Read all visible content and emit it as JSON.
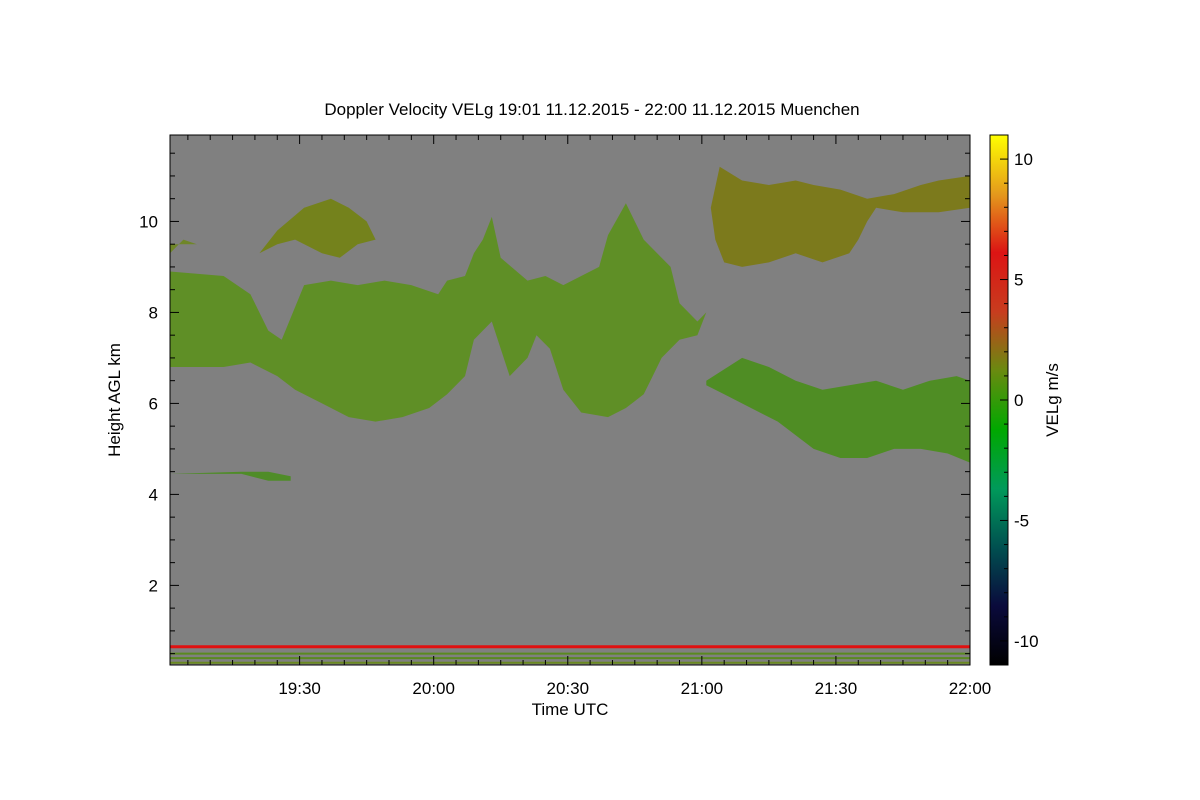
{
  "chart_data": {
    "type": "heatmap",
    "title": "Doppler Velocity VELg   19:01 11.12.2015 - 22:00 11.12.2015 Muenchen",
    "xlabel": "Time UTC",
    "ylabel": "Height AGL km",
    "x_range": [
      "19:01",
      "22:00"
    ],
    "x_tick_labels": [
      "19:30",
      "20:00",
      "20:30",
      "21:00",
      "21:30",
      "22:00"
    ],
    "x_tick_minutes": [
      29,
      59,
      89,
      119,
      149,
      179
    ],
    "ylim": [
      0.25,
      11.9
    ],
    "y_ticks": [
      2,
      4,
      6,
      8,
      10
    ],
    "y_tick_labels": [
      "2",
      "4",
      "6",
      "8",
      "10"
    ],
    "background_color": "#808080",
    "colorbar": {
      "label": "VELg m/s",
      "range": [
        -11,
        11
      ],
      "ticks": [
        10,
        5,
        0,
        -5,
        -10
      ],
      "tick_labels": [
        "10",
        "5",
        "0",
        "-5",
        "-10"
      ],
      "colors": [
        "#000000",
        "#0a0a3c",
        "#005050",
        "#009a5a",
        "#00a800",
        "#6a8a10",
        "#c83c1e",
        "#dc1414",
        "#e49a1c",
        "#ffff00"
      ]
    },
    "cloud_layers": [
      {
        "name": "upper",
        "color": "#6f8628",
        "outline": [
          [
            0,
            9.3
          ],
          [
            3,
            9.6
          ],
          [
            6,
            9.5
          ],
          [
            0,
            9.5
          ]
        ]
      },
      {
        "name": "middle",
        "color": "#5f8f26",
        "outline": [
          [
            0,
            8.9
          ],
          [
            12,
            8.8
          ],
          [
            18,
            8.4
          ],
          [
            22,
            7.6
          ],
          [
            25,
            7.4
          ],
          [
            30,
            8.6
          ],
          [
            36,
            8.7
          ],
          [
            42,
            8.6
          ],
          [
            48,
            8.7
          ],
          [
            54,
            8.6
          ],
          [
            60,
            8.4
          ],
          [
            62,
            8.7
          ],
          [
            66,
            8.8
          ],
          [
            68,
            9.3
          ],
          [
            70,
            9.6
          ],
          [
            72,
            10.1
          ],
          [
            74,
            9.2
          ],
          [
            80,
            8.7
          ],
          [
            84,
            8.8
          ],
          [
            88,
            8.6
          ],
          [
            92,
            8.8
          ],
          [
            96,
            9.0
          ],
          [
            98,
            9.7
          ],
          [
            102,
            10.4
          ],
          [
            106,
            9.6
          ],
          [
            112,
            9.0
          ],
          [
            114,
            8.2
          ],
          [
            118,
            7.8
          ],
          [
            120,
            8.0
          ],
          [
            118,
            7.5
          ],
          [
            114,
            7.4
          ],
          [
            110,
            7.0
          ],
          [
            108,
            6.6
          ],
          [
            106,
            6.2
          ],
          [
            102,
            5.9
          ],
          [
            98,
            5.7
          ],
          [
            92,
            5.8
          ],
          [
            88,
            6.3
          ],
          [
            85,
            7.2
          ],
          [
            82,
            7.5
          ],
          [
            80,
            7.0
          ],
          [
            76,
            6.6
          ],
          [
            74,
            7.2
          ],
          [
            72,
            7.8
          ],
          [
            68,
            7.4
          ],
          [
            66,
            6.6
          ],
          [
            62,
            6.2
          ],
          [
            58,
            5.9
          ],
          [
            52,
            5.7
          ],
          [
            46,
            5.6
          ],
          [
            40,
            5.7
          ],
          [
            34,
            6.0
          ],
          [
            28,
            6.3
          ],
          [
            24,
            6.6
          ],
          [
            18,
            6.9
          ],
          [
            12,
            6.8
          ],
          [
            6,
            6.8
          ],
          [
            0,
            6.8
          ]
        ]
      },
      {
        "name": "upper-left-patch",
        "color": "#74821c",
        "outline": [
          [
            20,
            9.3
          ],
          [
            24,
            9.8
          ],
          [
            30,
            10.3
          ],
          [
            36,
            10.5
          ],
          [
            40,
            10.3
          ],
          [
            44,
            10.0
          ],
          [
            46,
            9.6
          ],
          [
            42,
            9.5
          ],
          [
            38,
            9.2
          ],
          [
            34,
            9.3
          ],
          [
            28,
            9.6
          ],
          [
            24,
            9.5
          ],
          [
            20,
            9.3
          ]
        ]
      },
      {
        "name": "upper-right",
        "color": "#7c7a1c",
        "outline": [
          [
            123,
            11.2
          ],
          [
            128,
            10.9
          ],
          [
            134,
            10.8
          ],
          [
            140,
            10.9
          ],
          [
            144,
            10.8
          ],
          [
            150,
            10.7
          ],
          [
            156,
            10.5
          ],
          [
            162,
            10.6
          ],
          [
            168,
            10.8
          ],
          [
            172,
            10.9
          ],
          [
            179,
            11.0
          ],
          [
            179,
            10.3
          ],
          [
            172,
            10.2
          ],
          [
            164,
            10.2
          ],
          [
            158,
            10.3
          ],
          [
            156,
            10.0
          ],
          [
            154,
            9.6
          ],
          [
            152,
            9.3
          ],
          [
            146,
            9.1
          ],
          [
            140,
            9.3
          ],
          [
            134,
            9.1
          ],
          [
            128,
            9.0
          ],
          [
            124,
            9.1
          ],
          [
            122,
            9.6
          ],
          [
            121,
            10.3
          ],
          [
            123,
            11.2
          ]
        ]
      },
      {
        "name": "lower-right",
        "color": "#4f8d24",
        "outline": [
          [
            120,
            6.5
          ],
          [
            128,
            7.0
          ],
          [
            134,
            6.8
          ],
          [
            140,
            6.5
          ],
          [
            146,
            6.3
          ],
          [
            152,
            6.4
          ],
          [
            158,
            6.5
          ],
          [
            164,
            6.3
          ],
          [
            170,
            6.5
          ],
          [
            176,
            6.6
          ],
          [
            179,
            6.5
          ],
          [
            179,
            4.7
          ],
          [
            174,
            4.9
          ],
          [
            168,
            5.0
          ],
          [
            162,
            5.0
          ],
          [
            156,
            4.8
          ],
          [
            150,
            4.8
          ],
          [
            144,
            5.0
          ],
          [
            140,
            5.3
          ],
          [
            136,
            5.6
          ],
          [
            130,
            5.9
          ],
          [
            124,
            6.2
          ],
          [
            120,
            6.4
          ]
        ]
      },
      {
        "name": "low-left",
        "color": "#4f8c28",
        "outline": [
          [
            0,
            4.45
          ],
          [
            16,
            4.45
          ],
          [
            22,
            4.3
          ],
          [
            27,
            4.3
          ],
          [
            27,
            4.4
          ],
          [
            22,
            4.5
          ],
          [
            16,
            4.5
          ],
          [
            0,
            4.45
          ]
        ]
      }
    ],
    "surface_lines": [
      {
        "height": 0.65,
        "color": "#e01010"
      },
      {
        "height": 0.5,
        "color": "#5a8a20"
      },
      {
        "height": 0.4,
        "color": "#5a8a20"
      },
      {
        "height": 0.3,
        "color": "#6a8a20"
      }
    ]
  }
}
